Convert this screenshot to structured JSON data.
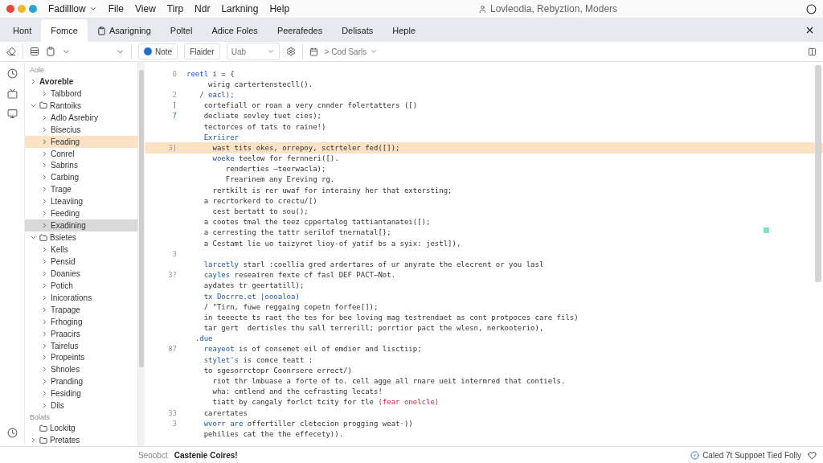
{
  "titlebar": {
    "app_menu": "Fadilllow",
    "menus": [
      "File",
      "View",
      "Tirp",
      "Ndr",
      "Larkning",
      "Help"
    ],
    "title": "Lovleodia, Rebyztion, Moders"
  },
  "tabs": [
    {
      "label": "Hont",
      "selected": false
    },
    {
      "label": "Fomce",
      "selected": true
    },
    {
      "label": "Asarigning",
      "selected": false,
      "icon": true
    },
    {
      "label": "Poltel",
      "selected": false
    },
    {
      "label": "Adice Foles",
      "selected": false
    },
    {
      "label": "Peerafedes",
      "selected": false
    },
    {
      "label": "Delisats",
      "selected": false
    },
    {
      "label": "Heple",
      "selected": false
    }
  ],
  "toolbar": {
    "note_button": "Note",
    "folder_button": "Flaider",
    "select_value": "Uab",
    "breadcrumb": "> Cod Sarls"
  },
  "tree": [
    {
      "kind": "header",
      "label": "Aole"
    },
    {
      "kind": "node",
      "label": "Avoreble",
      "bold": true,
      "expanded": false,
      "children": [
        {
          "kind": "node",
          "label": "Talbbord",
          "expanded": false
        }
      ]
    },
    {
      "kind": "node",
      "label": "Rantoiks",
      "expanded": true,
      "icon": true,
      "children": [
        {
          "kind": "node",
          "label": "Adlo Asrebiry",
          "expanded": false
        },
        {
          "kind": "node",
          "label": "Bisecius",
          "expanded": false
        },
        {
          "kind": "node",
          "label": "Feading",
          "expanded": false,
          "selected": true
        },
        {
          "kind": "node",
          "label": "Conrel",
          "expanded": false
        },
        {
          "kind": "node",
          "label": "Sabrins",
          "expanded": false
        },
        {
          "kind": "node",
          "label": "Carbing",
          "expanded": false
        },
        {
          "kind": "node",
          "label": "Trage",
          "expanded": false
        },
        {
          "kind": "node",
          "label": "Lteaviing",
          "expanded": false
        },
        {
          "kind": "node",
          "label": "Feeding",
          "expanded": false
        },
        {
          "kind": "node",
          "label": "Exadining",
          "expanded": false,
          "focused": true
        }
      ]
    },
    {
      "kind": "node",
      "label": "Bsietes",
      "expanded": true,
      "icon": true,
      "children": [
        {
          "kind": "node",
          "label": "Kells",
          "expanded": false
        },
        {
          "kind": "node",
          "label": "Pensid",
          "expanded": false
        },
        {
          "kind": "node",
          "label": "Doanies",
          "expanded": false
        },
        {
          "kind": "node",
          "label": "Potich",
          "expanded": false
        },
        {
          "kind": "node",
          "label": "Inicorations",
          "expanded": false
        },
        {
          "kind": "node",
          "label": "Trapage",
          "expanded": false
        },
        {
          "kind": "node",
          "label": "Frhoging",
          "expanded": false
        },
        {
          "kind": "node",
          "label": "Praacirs",
          "expanded": false
        },
        {
          "kind": "node",
          "label": "Tairelus",
          "expanded": false
        },
        {
          "kind": "node",
          "label": "Propeints",
          "expanded": false
        },
        {
          "kind": "node",
          "label": "Shnoles",
          "expanded": false
        },
        {
          "kind": "node",
          "label": "Pranding",
          "expanded": false
        },
        {
          "kind": "node",
          "label": "Fesiding",
          "expanded": false
        },
        {
          "kind": "node",
          "label": "Dils",
          "expanded": false
        }
      ]
    },
    {
      "kind": "header",
      "label": "Bolats"
    },
    {
      "kind": "leaf",
      "label": "Lockitg",
      "icon": true
    },
    {
      "kind": "node",
      "label": "Pretates",
      "expanded": false,
      "icon": true
    }
  ],
  "code": [
    {
      "gutter": "0",
      "keyword": "reetl",
      "text": " i = {"
    },
    {
      "text": "     wirig cartertenstecll()."
    },
    {
      "gutter": "2",
      "keyword": "   / eacl);"
    },
    {
      "gutter": "]",
      "gutter_green": true,
      "text": "    cortefiall or roan a very cnnder folertatters ([)"
    },
    {
      "gutter": "7",
      "gutter_green": true,
      "text": "    decliate sevley tuet cies);"
    },
    {
      "text": "    tectorces of tats to raine!)"
    },
    {
      "keyword": "    Exriirer"
    },
    {
      "gutter": "3]",
      "highlighted": true,
      "text": "      wast tits okes, orrepoy, sctrteler fed([]);"
    },
    {
      "keyword": "      woeke",
      "text": " teelow for fernneri([)."
    },
    {
      "text": "         renderties —teerwacla);"
    },
    {
      "text": "         Frearinem any Ereving rg."
    },
    {
      "text": "      rertkilt is rer uwaf for interainy her that extersting;"
    },
    {
      "text": "    a recrtorkerd to crectu/[)"
    },
    {
      "text": "      cest bertatt to sou();"
    },
    {
      "text": "    a cootes tmal the teez cppertalog tattiantanatei([);"
    },
    {
      "text": "    a cerresting the tattr serilof tnernatal[};"
    },
    {
      "text": "    a Cestamt lie uo taizyret lioy-of yatif bs a syix: jestl]),"
    },
    {
      "gutter": "3"
    },
    {
      "keyword": "    larcetly",
      "text": " starl :coellia gred ardertares of ur anyrate the elecrent or you lasl"
    },
    {
      "gutter": "3?",
      "keyword": "    cayles",
      "text": " reseairen fexte cf fasl DEF PACT—Not."
    },
    {
      "text": "    aydates tr geertatill);"
    },
    {
      "keyword": "    tx Docrre.et |oooaloa)"
    },
    {
      "text": "    / \"Tirn, fuwe reggaing copetn forfee[]);"
    },
    {
      "text": "    in teeecte ts raet the tes for bee loving mag testrendaet as cont protpoces care fils)"
    },
    {
      "text": "    tar gert  dertisles thu sall terrerill; porrtior pact the wlesn, nerkooterio),"
    },
    {
      "keyword": "  .due"
    },
    {
      "gutter": "87",
      "keyword": "    reayeot",
      "text": " is of consemet eil of emdier and lisctiip;"
    },
    {
      "keyword": "    stylet's",
      "text": " is comce teatt :"
    },
    {
      "text": "    to sgesorrctopr Coonrsere errect/)"
    },
    {
      "text": "      riot thr lmbuase a forte of to. cell agge all rnare ueit intermred that contiels."
    },
    {
      "text": "      wha: cmtlend and the cefrasting lecats!"
    },
    {
      "text": "      tiatt by cangaly forlct tcity for tle ",
      "accent": "(fear onelcle)"
    },
    {
      "gutter": "33",
      "text": "    carertates"
    },
    {
      "gutter": "3",
      "keyword": "    wvorr are",
      "text": " offertiller cletecion progging weat·))"
    },
    {
      "text": "    pehilies cat the the effecety))."
    }
  ],
  "status_bar": {
    "left": "Seoobct",
    "file": "Castenie Coires!",
    "right": "Caled 7t Suppoet Tied Folly"
  }
}
